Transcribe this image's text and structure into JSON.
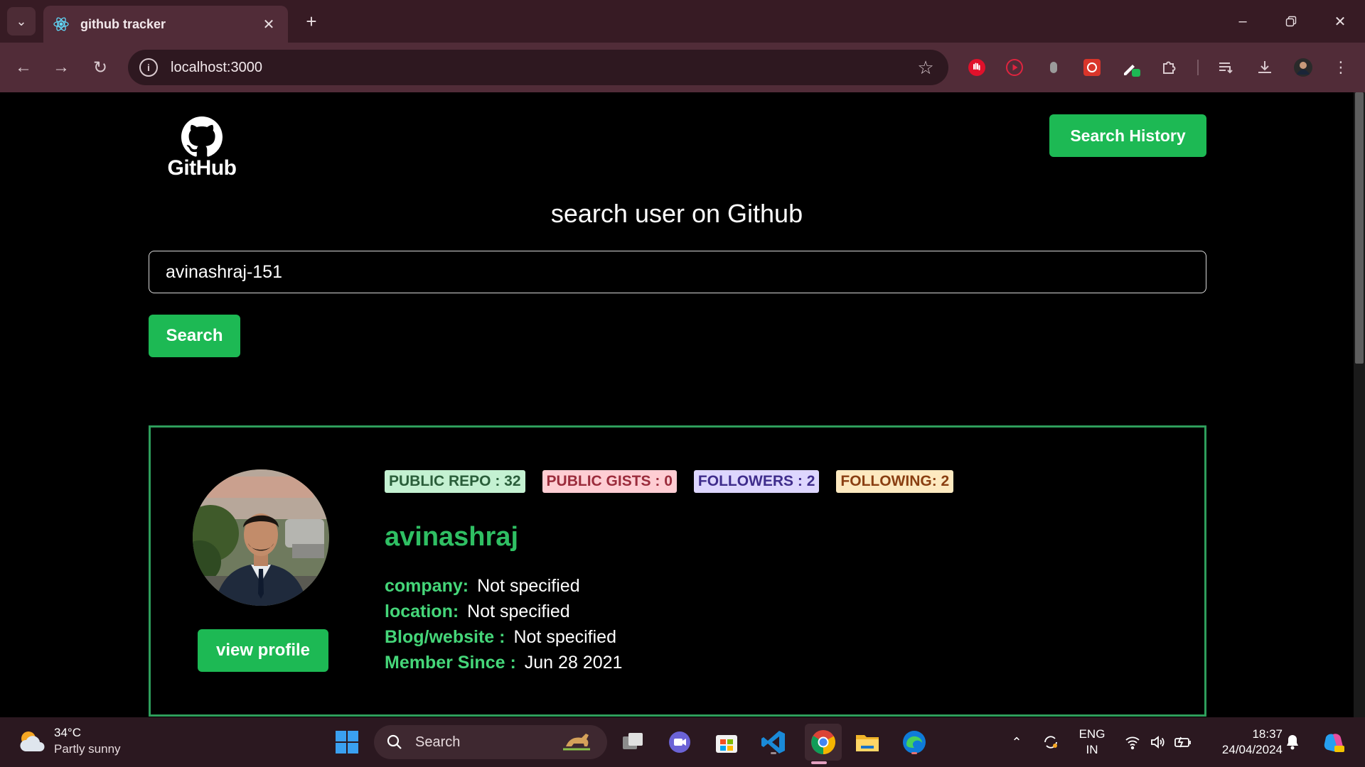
{
  "browser": {
    "tab_title": "github tracker",
    "url": "localhost:3000"
  },
  "page": {
    "logo_text": "GitHub",
    "history_button": "Search History",
    "heading": "search user on Github",
    "search_value": "avinashraj-151",
    "search_button": "Search"
  },
  "profile": {
    "badges": [
      {
        "label": "PUBLIC REPO : 32",
        "bg": "#c4f1d2",
        "fg": "#2a5e3a"
      },
      {
        "label": "PUBLIC GISTS : 0",
        "bg": "#fecdd3",
        "fg": "#9b2c3c"
      },
      {
        "label": "FOLLOWERS : 2",
        "bg": "#ddd6fe",
        "fg": "#3f2d8c"
      },
      {
        "label": "FOLLOWING: 2",
        "bg": "#fde9c0",
        "fg": "#8a3f12"
      }
    ],
    "username": "avinashraj",
    "details": [
      {
        "label": "company:",
        "value": "Not specified"
      },
      {
        "label": "location:",
        "value": "Not specified"
      },
      {
        "label": "Blog/website :",
        "value": "Not specified"
      },
      {
        "label": "Member Since :",
        "value": "Jun 28 2021"
      }
    ],
    "view_button": "view profile"
  },
  "taskbar": {
    "temp": "34°C",
    "weather": "Partly sunny",
    "search_placeholder": "Search",
    "lang_top": "ENG",
    "lang_bottom": "IN",
    "time": "18:37",
    "date": "24/04/2024"
  },
  "colors": {
    "accent": "#1db954",
    "card_border": "#2e9d5b",
    "username": "#2fbf63",
    "detail_label": "#45d679"
  }
}
